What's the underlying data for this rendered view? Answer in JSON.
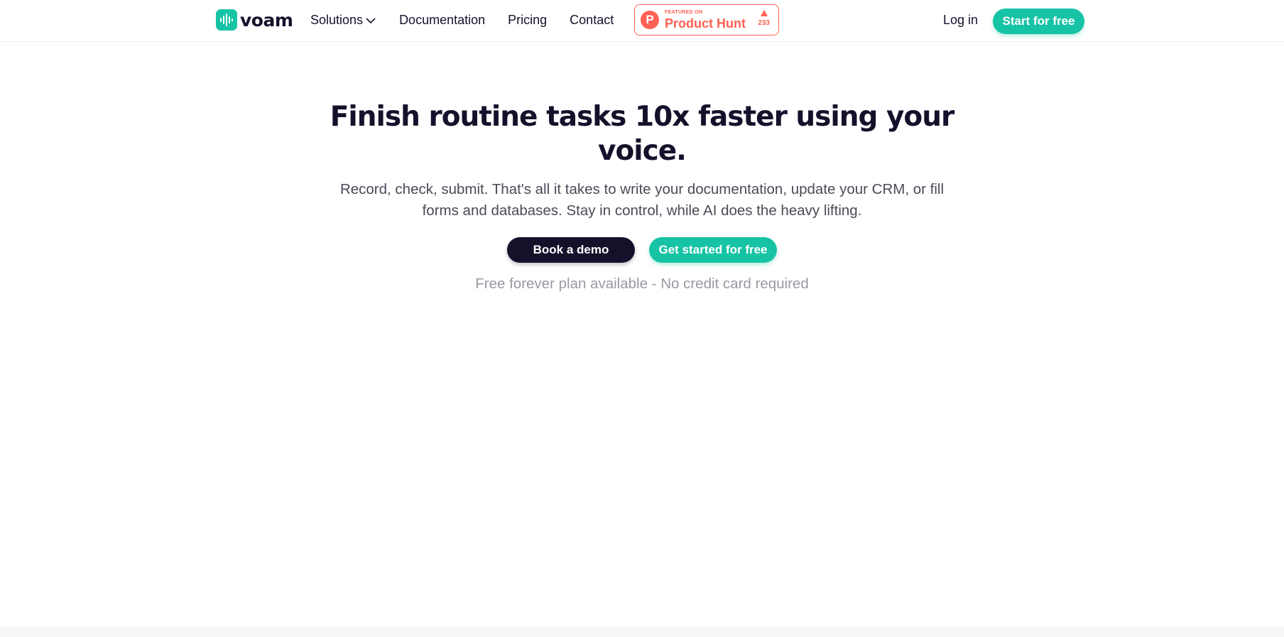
{
  "brand": {
    "name": "voam",
    "accent": "#17c3a5",
    "dark": "#14122b",
    "icon": "sound-wave-icon"
  },
  "nav": {
    "items": [
      {
        "label": "Solutions",
        "has_dropdown": true
      },
      {
        "label": "Documentation"
      },
      {
        "label": "Pricing"
      },
      {
        "label": "Contact"
      }
    ]
  },
  "product_hunt": {
    "featured_label": "FEATURED ON",
    "name": "Product Hunt",
    "votes": "233",
    "color": "#ff6154"
  },
  "header_actions": {
    "login_label": "Log in",
    "start_label": "Start for free"
  },
  "hero": {
    "title": "Finish routine tasks 10x faster using your voice.",
    "subtitle": "Record, check, submit. That's all it takes to write your documentation, update your CRM, or fill forms and databases. Stay in control, while AI does the heavy lifting.",
    "demo_label": "Book a demo",
    "get_started_label": "Get started for free",
    "note": "Free forever plan available - No credit card required"
  }
}
